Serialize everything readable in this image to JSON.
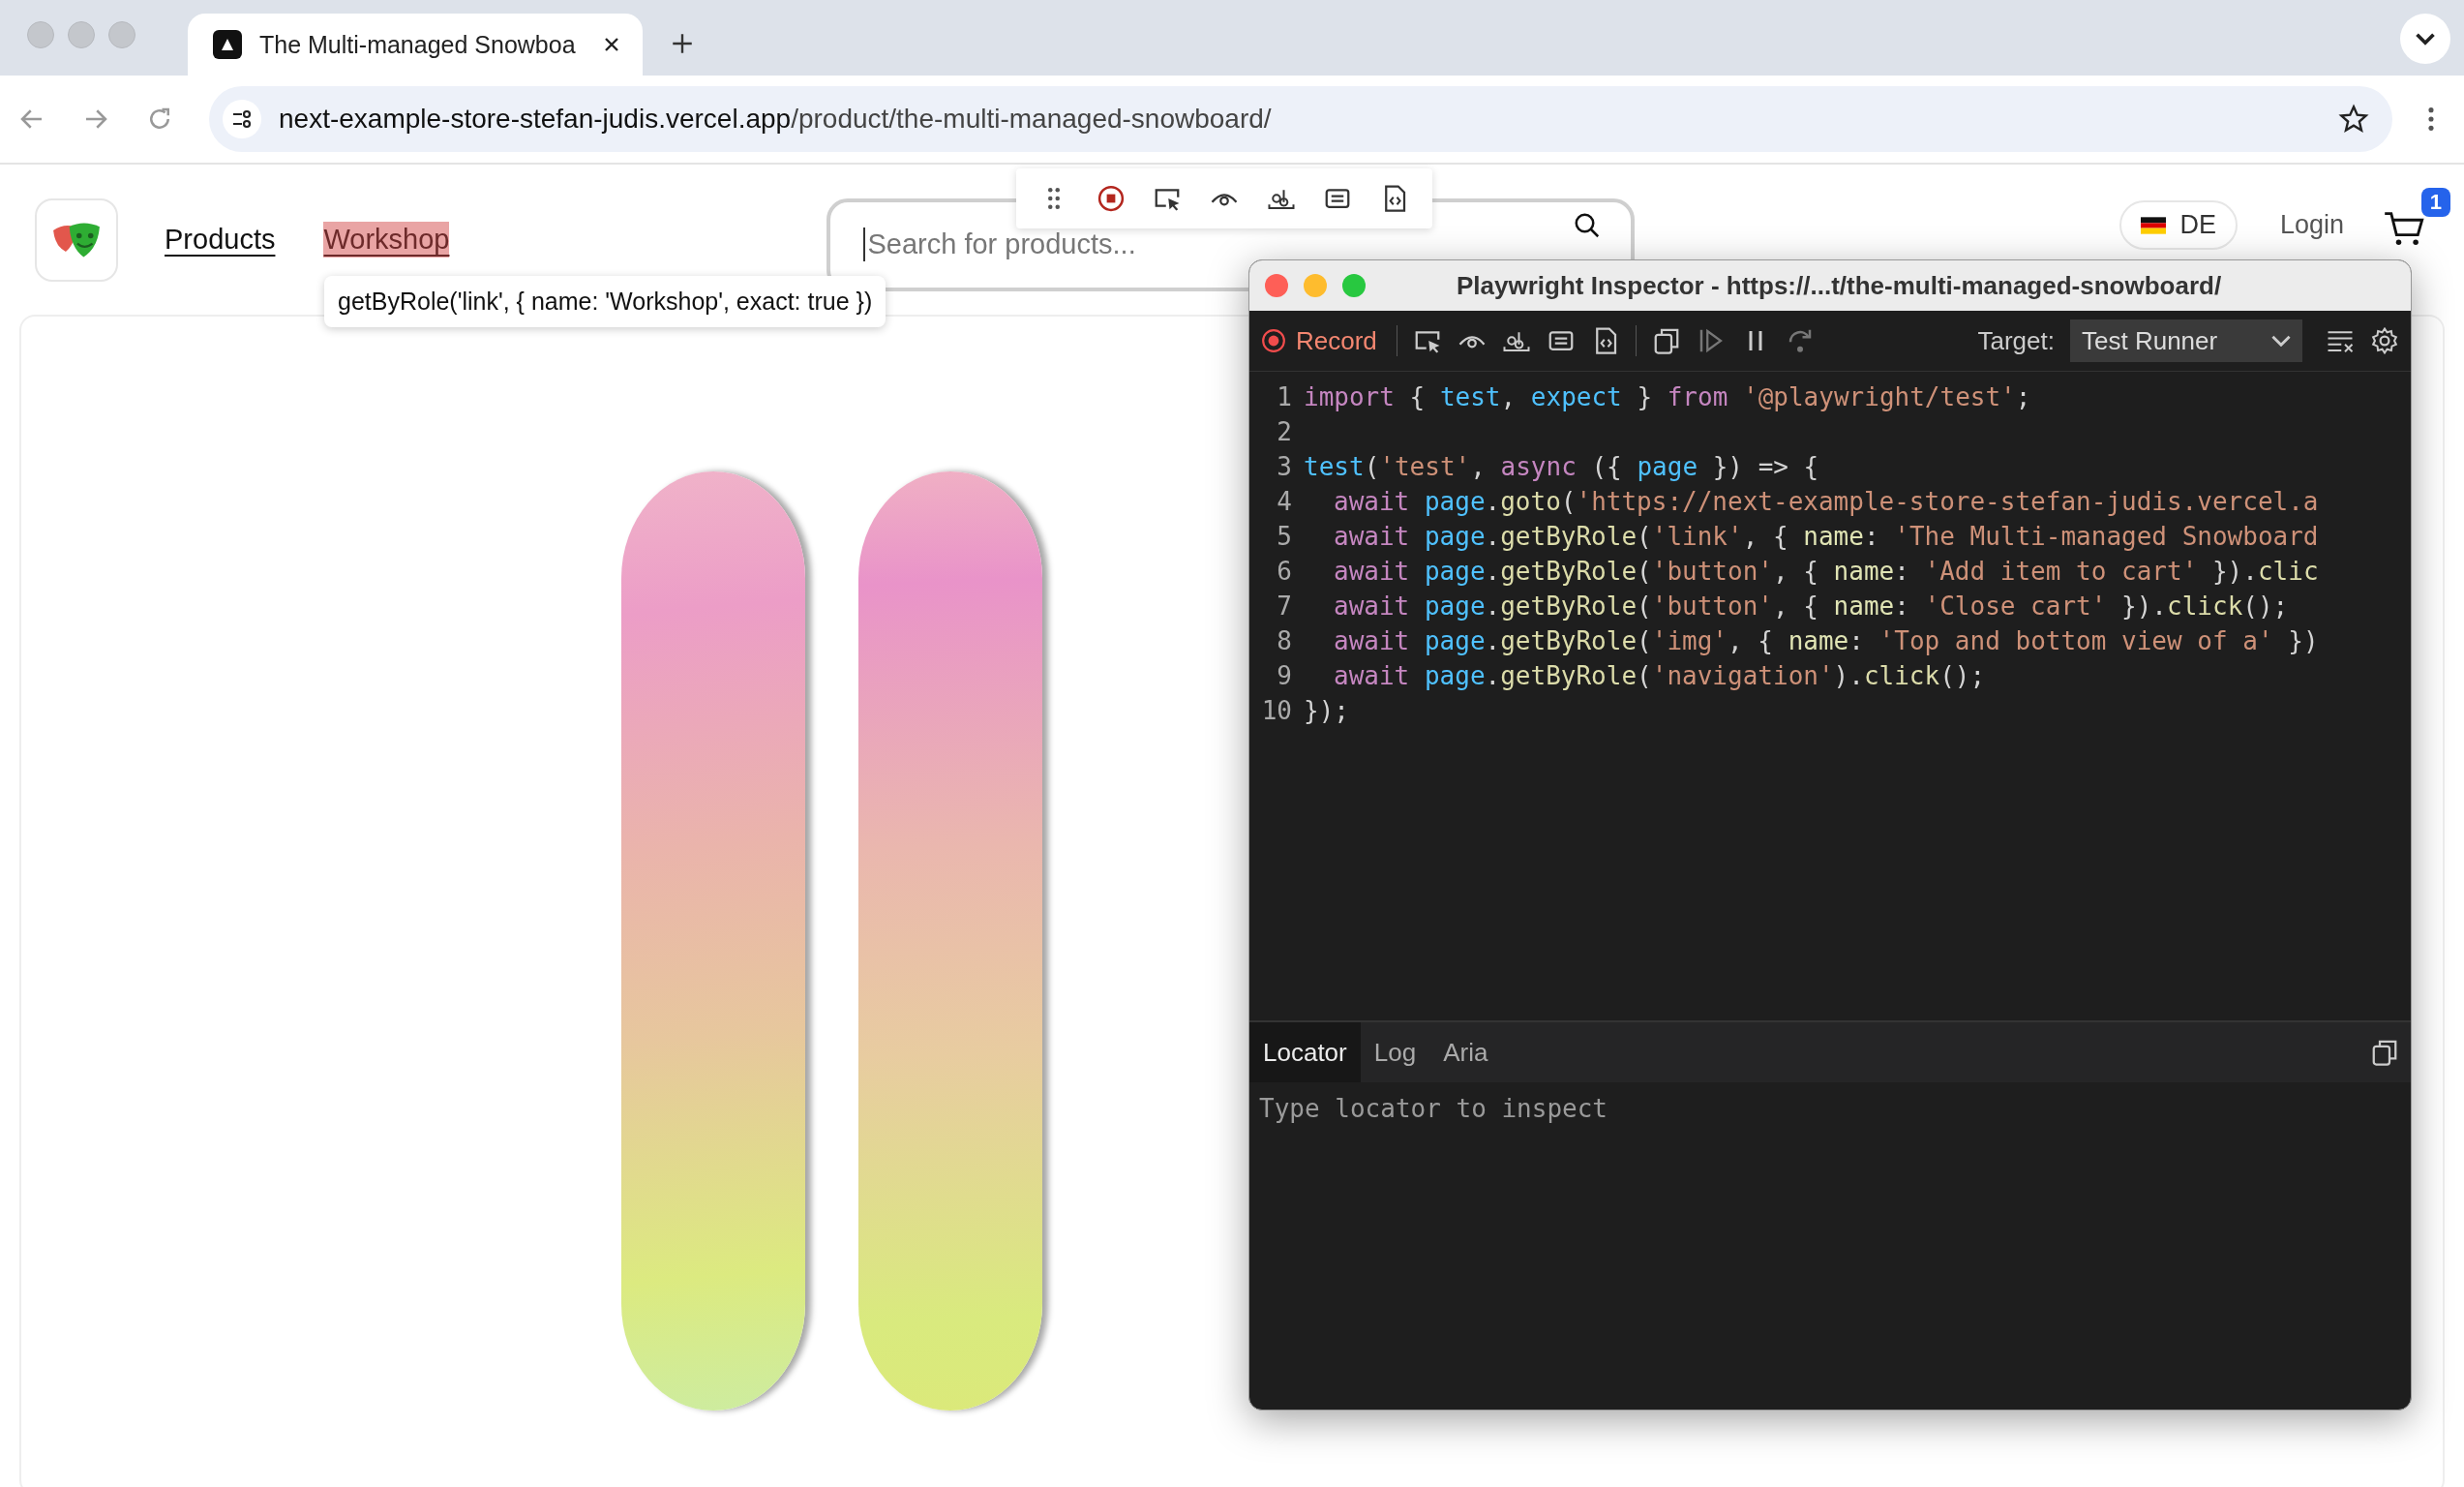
{
  "browser": {
    "tab": {
      "title": "The Multi-managed Snowboa",
      "selected": true
    },
    "address": {
      "host": "next-example-store-stefan-judis.vercel.app",
      "path": "/product/the-multi-managed-snowboard/"
    }
  },
  "header": {
    "nav": [
      {
        "label": "Products",
        "highlighted": false
      },
      {
        "label": "Workshop",
        "highlighted": true
      }
    ],
    "tooltip": "getByRole('link', { name: 'Workshop', exact: true })",
    "search": {
      "placeholder": "Search for products..."
    },
    "language": "DE",
    "login": "Login",
    "cart_count": "1"
  },
  "inspector": {
    "title": "Playwright Inspector - https://...t/the-multi-managed-snowboard/",
    "record_label": "Record",
    "target_label": "Target:",
    "target_value": "Test Runner",
    "code": [
      {
        "number": "1",
        "indented": false,
        "tokens": [
          {
            "text": "import",
            "kind": "keyword"
          },
          {
            "text": " { ",
            "kind": "plain"
          },
          {
            "text": "test",
            "kind": "variable"
          },
          {
            "text": ", ",
            "kind": "plain"
          },
          {
            "text": "expect",
            "kind": "variable"
          },
          {
            "text": " } ",
            "kind": "plain"
          },
          {
            "text": "from ",
            "kind": "keyword"
          },
          {
            "text": "'@playwright/test'",
            "kind": "string"
          },
          {
            "text": ";",
            "kind": "plain"
          }
        ]
      },
      {
        "number": "2"
      },
      {
        "number": "3",
        "indented": false,
        "tokens": [
          {
            "text": "test",
            "kind": "variable"
          },
          {
            "text": "(",
            "kind": "plain"
          },
          {
            "text": "'test'",
            "kind": "string"
          },
          {
            "text": ", ",
            "kind": "plain"
          },
          {
            "text": "async",
            "kind": "keyword"
          },
          {
            "text": " ({ ",
            "kind": "plain"
          },
          {
            "text": "page",
            "kind": "variable"
          },
          {
            "text": " }) => {",
            "kind": "plain"
          }
        ]
      },
      {
        "number": "4",
        "indented": true,
        "tokens": [
          {
            "text": "await ",
            "kind": "keyword"
          },
          {
            "text": "page",
            "kind": "variable"
          },
          {
            "text": ".",
            "kind": "plain"
          },
          {
            "text": "goto",
            "kind": "function"
          },
          {
            "text": "(",
            "kind": "plain"
          },
          {
            "text": "'https://next-example-store-stefan-judis.vercel.a",
            "kind": "string"
          }
        ]
      },
      {
        "number": "5",
        "indented": true,
        "tokens": [
          {
            "text": "await ",
            "kind": "keyword"
          },
          {
            "text": "page",
            "kind": "variable"
          },
          {
            "text": ".",
            "kind": "plain"
          },
          {
            "text": "getByRole",
            "kind": "function"
          },
          {
            "text": "(",
            "kind": "plain"
          },
          {
            "text": "'link'",
            "kind": "string"
          },
          {
            "text": ", { ",
            "kind": "plain"
          },
          {
            "text": "name",
            "kind": "property"
          },
          {
            "text": ": ",
            "kind": "plain"
          },
          {
            "text": "'The Multi-managed Snowboard",
            "kind": "string"
          }
        ]
      },
      {
        "number": "6",
        "indented": true,
        "tokens": [
          {
            "text": "await ",
            "kind": "keyword"
          },
          {
            "text": "page",
            "kind": "variable"
          },
          {
            "text": ".",
            "kind": "plain"
          },
          {
            "text": "getByRole",
            "kind": "function"
          },
          {
            "text": "(",
            "kind": "plain"
          },
          {
            "text": "'button'",
            "kind": "string"
          },
          {
            "text": ", { ",
            "kind": "plain"
          },
          {
            "text": "name",
            "kind": "property"
          },
          {
            "text": ": ",
            "kind": "plain"
          },
          {
            "text": "'Add item to cart'",
            "kind": "string"
          },
          {
            "text": " }).",
            "kind": "plain"
          },
          {
            "text": "clic",
            "kind": "function"
          }
        ]
      },
      {
        "number": "7",
        "indented": true,
        "tokens": [
          {
            "text": "await ",
            "kind": "keyword"
          },
          {
            "text": "page",
            "kind": "variable"
          },
          {
            "text": ".",
            "kind": "plain"
          },
          {
            "text": "getByRole",
            "kind": "function"
          },
          {
            "text": "(",
            "kind": "plain"
          },
          {
            "text": "'button'",
            "kind": "string"
          },
          {
            "text": ", { ",
            "kind": "plain"
          },
          {
            "text": "name",
            "kind": "property"
          },
          {
            "text": ": ",
            "kind": "plain"
          },
          {
            "text": "'Close cart'",
            "kind": "string"
          },
          {
            "text": " }).",
            "kind": "plain"
          },
          {
            "text": "click",
            "kind": "function"
          },
          {
            "text": "();",
            "kind": "plain"
          }
        ]
      },
      {
        "number": "8",
        "indented": true,
        "tokens": [
          {
            "text": "await ",
            "kind": "keyword"
          },
          {
            "text": "page",
            "kind": "variable"
          },
          {
            "text": ".",
            "kind": "plain"
          },
          {
            "text": "getByRole",
            "kind": "function"
          },
          {
            "text": "(",
            "kind": "plain"
          },
          {
            "text": "'img'",
            "kind": "string"
          },
          {
            "text": ", { ",
            "kind": "plain"
          },
          {
            "text": "name",
            "kind": "property"
          },
          {
            "text": ": ",
            "kind": "plain"
          },
          {
            "text": "'Top and bottom view of a'",
            "kind": "string"
          },
          {
            "text": " })",
            "kind": "plain"
          }
        ]
      },
      {
        "number": "9",
        "indented": true,
        "tokens": [
          {
            "text": "await ",
            "kind": "keyword"
          },
          {
            "text": "page",
            "kind": "variable"
          },
          {
            "text": ".",
            "kind": "plain"
          },
          {
            "text": "getByRole",
            "kind": "function"
          },
          {
            "text": "(",
            "kind": "plain"
          },
          {
            "text": "'navigation'",
            "kind": "string"
          },
          {
            "text": ").",
            "kind": "plain"
          },
          {
            "text": "click",
            "kind": "function"
          },
          {
            "text": "();",
            "kind": "plain"
          }
        ]
      },
      {
        "number": "10",
        "indented": false,
        "tokens": [
          {
            "text": "});",
            "kind": "plain"
          }
        ]
      }
    ],
    "tabs": [
      {
        "label": "Locator",
        "selected": true
      },
      {
        "label": "Log",
        "selected": false
      },
      {
        "label": "Aria",
        "selected": false
      }
    ],
    "locator": {
      "placeholder": "Type locator to inspect"
    }
  }
}
